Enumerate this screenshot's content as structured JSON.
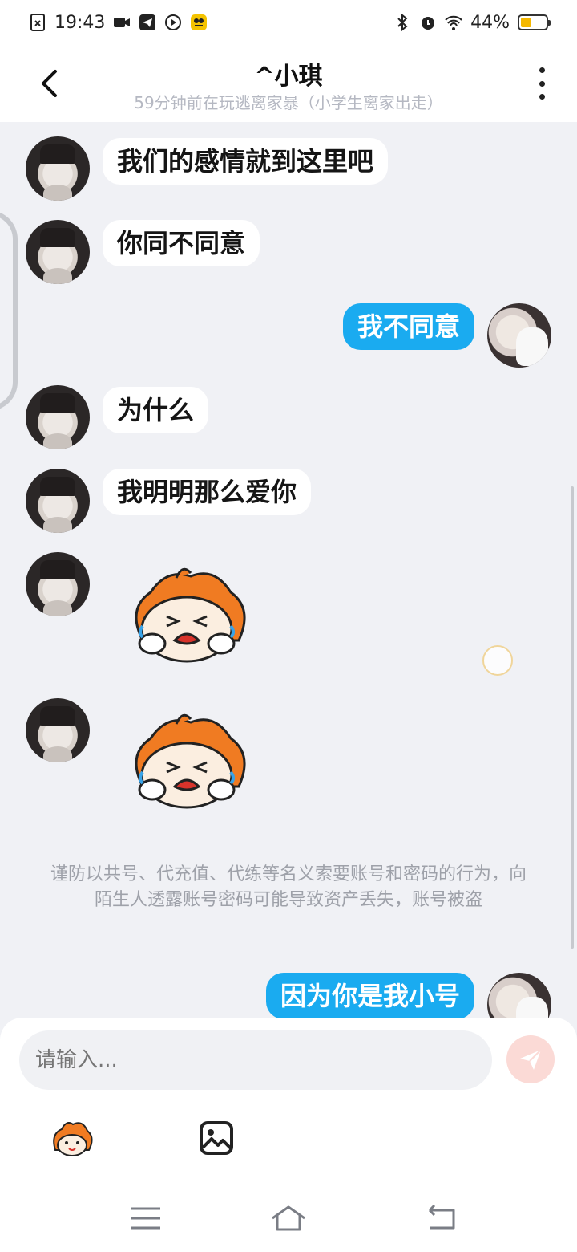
{
  "status_bar": {
    "time": "19:43",
    "battery_percent_text": "44%",
    "battery_level": 0.44,
    "battery_color": "#f5b800"
  },
  "header": {
    "title": "^小琪",
    "subtitle": "59分钟前在玩逃离家暴（小学生离家出走）"
  },
  "messages": [
    {
      "side": "in",
      "type": "text",
      "text": "我们的感情就到这里吧"
    },
    {
      "side": "in",
      "type": "text",
      "text": "你同不同意"
    },
    {
      "side": "out",
      "type": "text",
      "text": "我不同意"
    },
    {
      "side": "in",
      "type": "text",
      "text": "为什么"
    },
    {
      "side": "in",
      "type": "text",
      "text": "我明明那么爱你"
    },
    {
      "side": "in",
      "type": "sticker",
      "sticker": "crying-mascot"
    },
    {
      "side": "in",
      "type": "sticker",
      "sticker": "crying-mascot"
    },
    {
      "side": "out",
      "type": "text",
      "text": "因为你是我小号"
    }
  ],
  "notice": "谨防以共号、代充值、代练等名义索要账号和密码的行为，向陌生人透露账号密码可能导致资产丢失，账号被盗",
  "input": {
    "placeholder": "请输入..."
  },
  "colors": {
    "outgoing_bubble": "#1aabf0",
    "incoming_bubble": "#ffffff",
    "background": "#f0f1f5",
    "send_button": "#fbdad6"
  },
  "icons": {
    "back": "back-arrow-icon",
    "more": "more-vertical-icon",
    "send": "send-paper-plane-icon",
    "emoji": "mascot-emoji-icon",
    "image": "image-gallery-icon"
  }
}
